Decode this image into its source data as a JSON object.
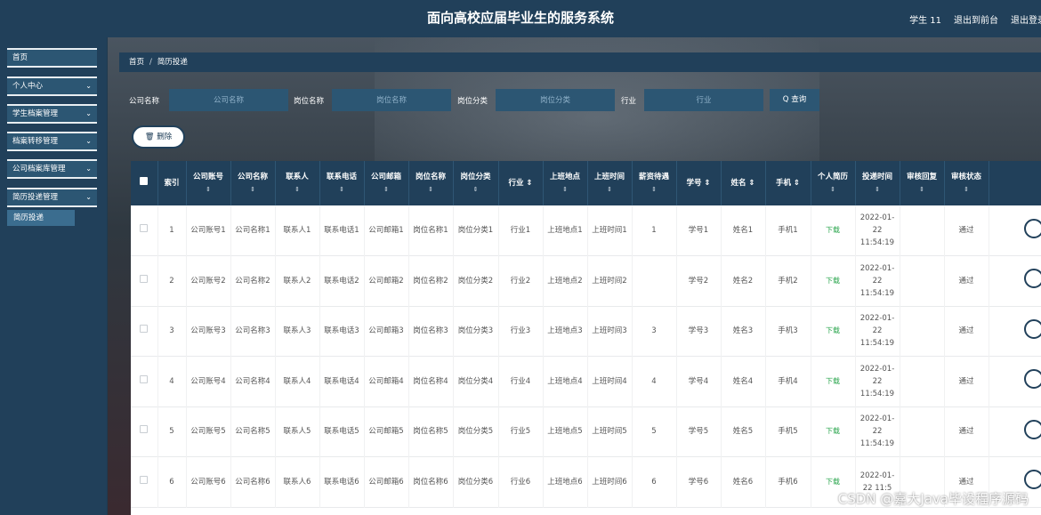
{
  "header": {
    "title": "面向高校应届毕业生的服务系统",
    "user": "学生 11",
    "back_front": "退出到前台",
    "logout": "退出登录"
  },
  "sidebar": {
    "items": [
      {
        "label": "首页",
        "has_chevron": false
      },
      {
        "label": "个人中心",
        "has_chevron": true
      },
      {
        "label": "学生档案管理",
        "has_chevron": true
      },
      {
        "label": "档案转移管理",
        "has_chevron": true
      },
      {
        "label": "公司档案库管理",
        "has_chevron": true
      },
      {
        "label": "简历投递管理",
        "has_chevron": true
      }
    ],
    "chevron": "⌄",
    "sub_item": "简历投递"
  },
  "breadcrumb": {
    "home": "首页",
    "sep": "/",
    "current": "简历投递"
  },
  "search": {
    "fields": [
      {
        "label": "公司名称",
        "placeholder": "公司名称"
      },
      {
        "label": "岗位名称",
        "placeholder": "岗位名称"
      },
      {
        "label": "岗位分类",
        "placeholder": "岗位分类"
      },
      {
        "label": "行业",
        "placeholder": "行业"
      }
    ],
    "query_label": "Q 查询"
  },
  "delete_label": "🗑 删除",
  "table": {
    "sort_glyph": "⇕",
    "columns": [
      {
        "label": "",
        "sortable": false
      },
      {
        "label": "索引",
        "sortable": false
      },
      {
        "label": "公司账号",
        "sortable": true
      },
      {
        "label": "公司名称",
        "sortable": true
      },
      {
        "label": "联系人",
        "sortable": true
      },
      {
        "label": "联系电话",
        "sortable": true
      },
      {
        "label": "公司邮箱",
        "sortable": true
      },
      {
        "label": "岗位名称",
        "sortable": true
      },
      {
        "label": "岗位分类",
        "sortable": true
      },
      {
        "label": "行业 ⇕",
        "sortable": false
      },
      {
        "label": "上班地点",
        "sortable": true
      },
      {
        "label": "上班时间",
        "sortable": true
      },
      {
        "label": "薪资待遇",
        "sortable": true
      },
      {
        "label": "学号 ⇕",
        "sortable": false
      },
      {
        "label": "姓名 ⇕",
        "sortable": false
      },
      {
        "label": "手机 ⇕",
        "sortable": false
      },
      {
        "label": "个人简历",
        "sortable": true
      },
      {
        "label": "投递时间",
        "sortable": true
      },
      {
        "label": "审核回复",
        "sortable": true
      },
      {
        "label": "审核状态",
        "sortable": true
      },
      {
        "label": "",
        "sortable": false
      }
    ],
    "rows": [
      {
        "idx": "1",
        "acct": "公司账号1",
        "name": "公司名称1",
        "contact": "联系人1",
        "phone": "联系电话1",
        "email": "公司邮箱1",
        "post": "岗位名称1",
        "cat": "岗位分类1",
        "industry": "行业1",
        "place": "上班地点1",
        "time": "上班时间1",
        "salary": "1",
        "sno": "学号1",
        "sname": "姓名1",
        "mobile": "手机1",
        "resume": "下载",
        "date": "2022-01-22 11:54:19",
        "reply": "",
        "status": "通过"
      },
      {
        "idx": "2",
        "acct": "公司账号2",
        "name": "公司名称2",
        "contact": "联系人2",
        "phone": "联系电话2",
        "email": "公司邮箱2",
        "post": "岗位名称2",
        "cat": "岗位分类2",
        "industry": "行业2",
        "place": "上班地点2",
        "time": "上班时间2",
        "salary": "",
        "sno": "学号2",
        "sname": "姓名2",
        "mobile": "手机2",
        "resume": "下载",
        "date": "2022-01-22 11:54:19",
        "reply": "",
        "status": "通过"
      },
      {
        "idx": "3",
        "acct": "公司账号3",
        "name": "公司名称3",
        "contact": "联系人3",
        "phone": "联系电话3",
        "email": "公司邮箱3",
        "post": "岗位名称3",
        "cat": "岗位分类3",
        "industry": "行业3",
        "place": "上班地点3",
        "time": "上班时间3",
        "salary": "3",
        "sno": "学号3",
        "sname": "姓名3",
        "mobile": "手机3",
        "resume": "下载",
        "date": "2022-01-22 11:54:19",
        "reply": "",
        "status": "通过"
      },
      {
        "idx": "4",
        "acct": "公司账号4",
        "name": "公司名称4",
        "contact": "联系人4",
        "phone": "联系电话4",
        "email": "公司邮箱4",
        "post": "岗位名称4",
        "cat": "岗位分类4",
        "industry": "行业4",
        "place": "上班地点4",
        "time": "上班时间4",
        "salary": "4",
        "sno": "学号4",
        "sname": "姓名4",
        "mobile": "手机4",
        "resume": "下载",
        "date": "2022-01-22 11:54:19",
        "reply": "",
        "status": "通过"
      },
      {
        "idx": "5",
        "acct": "公司账号5",
        "name": "公司名称5",
        "contact": "联系人5",
        "phone": "联系电话5",
        "email": "公司邮箱5",
        "post": "岗位名称5",
        "cat": "岗位分类5",
        "industry": "行业5",
        "place": "上班地点5",
        "time": "上班时间5",
        "salary": "5",
        "sno": "学号5",
        "sname": "姓名5",
        "mobile": "手机5",
        "resume": "下载",
        "date": "2022-01-22 11:54:19",
        "reply": "",
        "status": "通过"
      },
      {
        "idx": "6",
        "acct": "公司账号6",
        "name": "公司名称6",
        "contact": "联系人6",
        "phone": "联系电话6",
        "email": "公司邮箱6",
        "post": "岗位名称6",
        "cat": "岗位分类6",
        "industry": "行业6",
        "place": "上班地点6",
        "time": "上班时间6",
        "salary": "6",
        "sno": "学号6",
        "sname": "姓名6",
        "mobile": "手机6",
        "resume": "下载",
        "date": "2022-01-22 11:5",
        "reply": "",
        "status": "通过"
      }
    ]
  },
  "watermark": "CSDN @嘉大Java毕设程序源码",
  "colors": {
    "navy": "#21405a",
    "panel": "#2c5673",
    "download_green": "#2aa54d"
  }
}
